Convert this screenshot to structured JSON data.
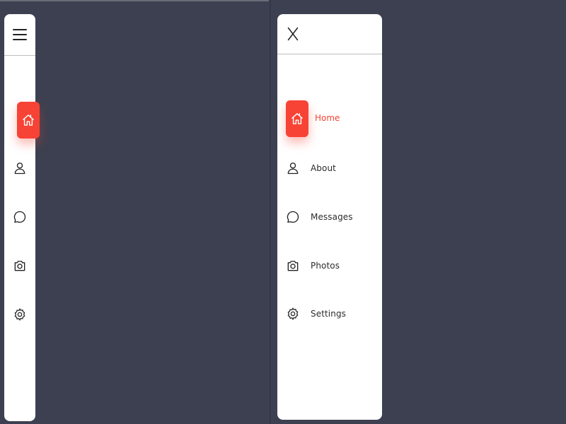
{
  "theme": {
    "background": "#3d4050",
    "panel": "#ffffff",
    "accent": "#f74335",
    "text": "#2b2b2b"
  },
  "collapsed_nav": {
    "toggle_icon": "hamburger-menu-icon",
    "active_item": "home",
    "items": [
      {
        "id": "home",
        "icon": "home-icon"
      },
      {
        "id": "about",
        "icon": "user-icon"
      },
      {
        "id": "messages",
        "icon": "chat-bubble-icon"
      },
      {
        "id": "photos",
        "icon": "camera-icon"
      },
      {
        "id": "settings",
        "icon": "gear-icon"
      }
    ]
  },
  "expanded_nav": {
    "toggle_icon": "close-icon",
    "active_item": "home",
    "items": [
      {
        "id": "home",
        "label": "Home",
        "icon": "home-icon"
      },
      {
        "id": "about",
        "label": "About",
        "icon": "user-icon"
      },
      {
        "id": "messages",
        "label": "Messages",
        "icon": "chat-bubble-icon"
      },
      {
        "id": "photos",
        "label": "Photos",
        "icon": "camera-icon"
      },
      {
        "id": "settings",
        "label": "Settings",
        "icon": "gear-icon"
      }
    ]
  }
}
